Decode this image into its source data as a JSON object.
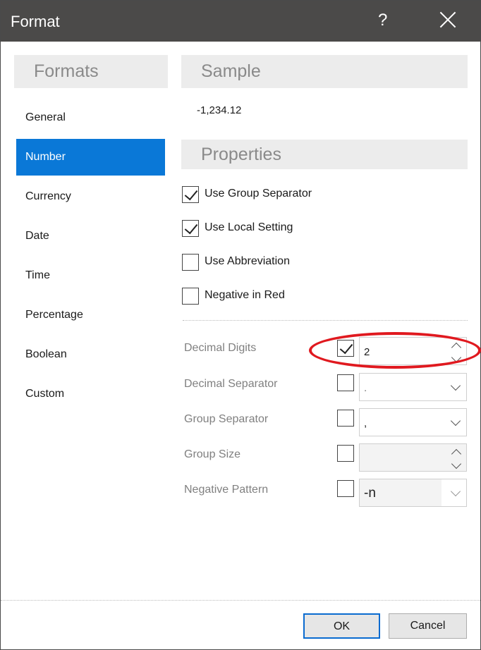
{
  "window": {
    "title": "Format",
    "help_label": "?"
  },
  "formats_panel": {
    "header": "Formats",
    "items": [
      {
        "label": "General",
        "selected": false
      },
      {
        "label": "Number",
        "selected": true
      },
      {
        "label": "Currency",
        "selected": false
      },
      {
        "label": "Date",
        "selected": false
      },
      {
        "label": "Time",
        "selected": false
      },
      {
        "label": "Percentage",
        "selected": false
      },
      {
        "label": "Boolean",
        "selected": false
      },
      {
        "label": "Custom",
        "selected": false
      }
    ]
  },
  "sample": {
    "header": "Sample",
    "value": "-1,234.12"
  },
  "properties": {
    "header": "Properties",
    "checkboxes": [
      {
        "label": "Use Group Separator",
        "checked": true
      },
      {
        "label": "Use Local Setting",
        "checked": true
      },
      {
        "label": "Use Abbreviation",
        "checked": false
      },
      {
        "label": "Negative in Red",
        "checked": false
      }
    ],
    "fields": [
      {
        "label": "Decimal Digits",
        "enabled": true,
        "value": "2",
        "control": "spinner"
      },
      {
        "label": "Decimal Separator",
        "enabled": false,
        "value": ".",
        "control": "dropdown"
      },
      {
        "label": "Group Separator",
        "enabled": false,
        "value": ",",
        "control": "dropdown"
      },
      {
        "label": "Group Size",
        "enabled": false,
        "value": "",
        "control": "spinner"
      },
      {
        "label": "Negative Pattern",
        "enabled": false,
        "value": "-n",
        "control": "dropdown"
      }
    ]
  },
  "buttons": {
    "ok": "OK",
    "cancel": "Cancel"
  },
  "colors": {
    "titlebar": "#4b4a49",
    "accent": "#0a78d7",
    "highlight_ellipse": "#e0191f"
  }
}
